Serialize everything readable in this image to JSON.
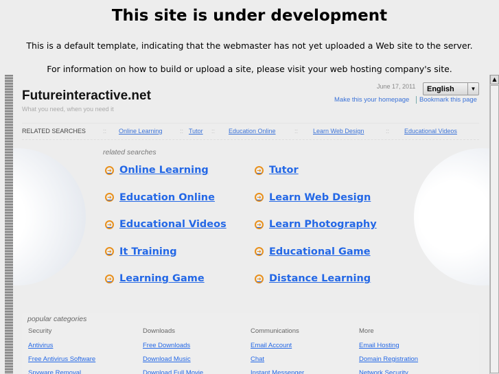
{
  "notice": {
    "title": "This site is under development",
    "line1": "This is a default template, indicating that the webmaster has not yet uploaded a Web site to the server.",
    "line2": "For information on how to build or upload a site, please visit your web hosting company's site."
  },
  "site": {
    "name": "Futureinteractive.net",
    "tagline": "What you need, when you need it",
    "date": "June 17, 2011",
    "language": "English",
    "homepage_link": "Make this your homepage",
    "bookmark_link": "Bookmark this page"
  },
  "related_bar": {
    "label": "RELATED SEARCHES",
    "links": [
      "Online Learning",
      "Tutor",
      "Education Online",
      "Learn Web Design",
      "Educational Videos"
    ]
  },
  "related": {
    "heading": "related searches",
    "left": [
      "Online Learning",
      "Education Online",
      "Educational Videos",
      "It Training",
      "Learning Game"
    ],
    "right": [
      "Tutor",
      "Learn Web Design",
      "Learn Photography",
      "Educational Game",
      "Distance Learning"
    ]
  },
  "popular": {
    "heading": "popular categories",
    "columns": [
      {
        "title": "Security",
        "links": [
          "Antivirus",
          "Free Antivirus Software",
          "Spyware Removal"
        ]
      },
      {
        "title": "Downloads",
        "links": [
          "Free Downloads",
          "Download Music",
          "Download Full Movie"
        ]
      },
      {
        "title": "Communications",
        "links": [
          "Email Account",
          "Chat",
          "Instant Messenger"
        ]
      },
      {
        "title": "More",
        "links": [
          "Email Hosting",
          "Domain Registration",
          "Network Security"
        ]
      }
    ]
  },
  "colors": {
    "link": "#2468e6",
    "arrow": "#e8901c"
  }
}
